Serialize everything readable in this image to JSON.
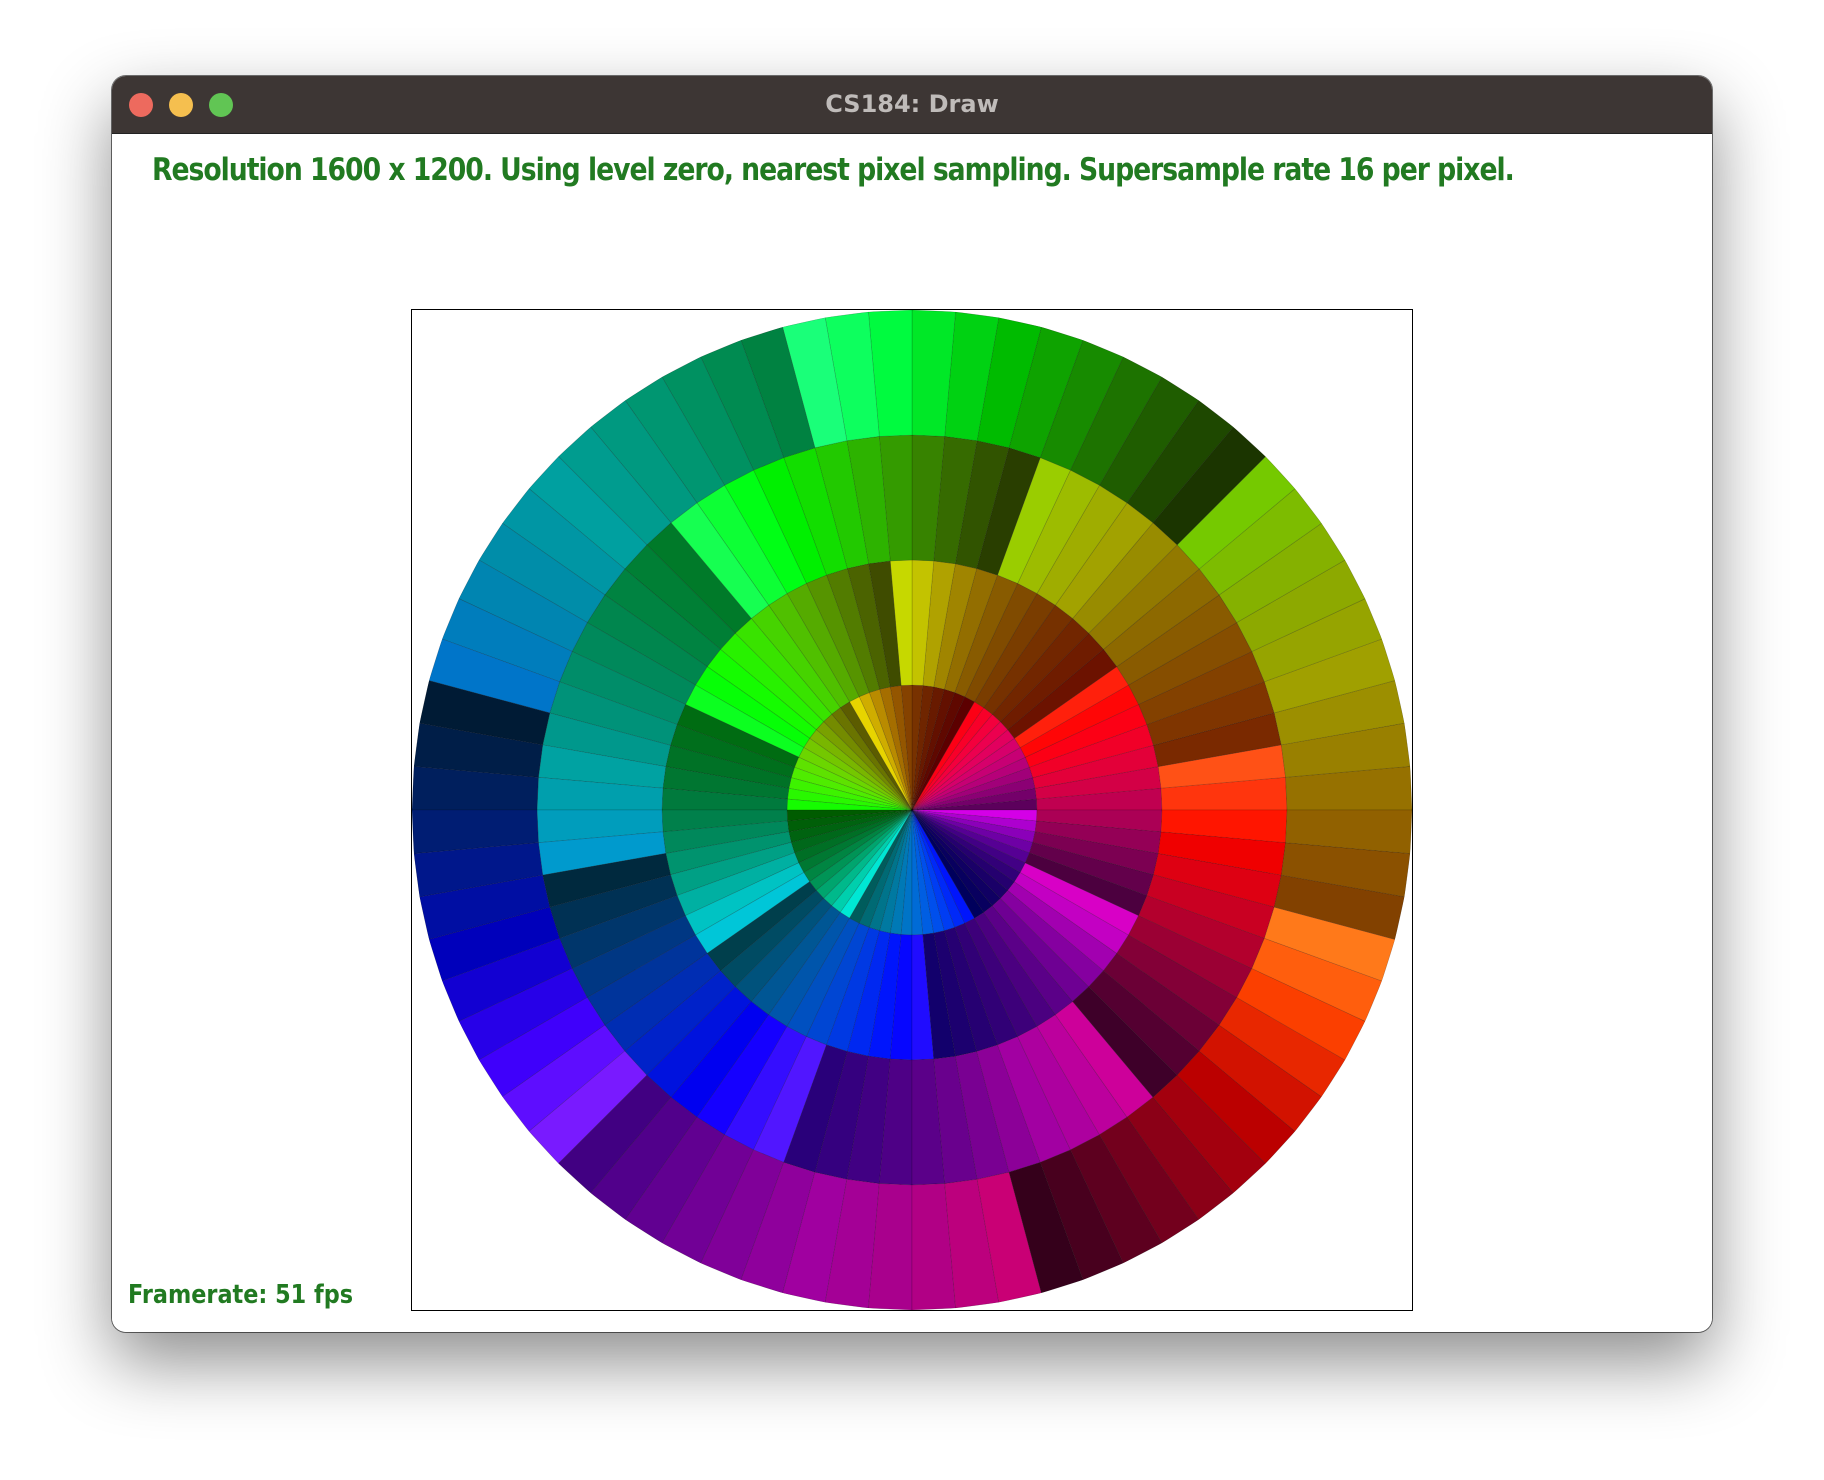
{
  "window": {
    "title": "CS184: Draw"
  },
  "status": {
    "message": "Resolution 1600 x 1200. Using level zero, nearest pixel sampling. Supersample rate 16 per pixel.",
    "framerate": "Framerate: 51 fps"
  },
  "colors": {
    "status_text": "#217a21",
    "titlebar": "#3d3634",
    "close": "#ed6a5e",
    "minimize": "#f5bf4f",
    "zoom": "#61c554"
  },
  "icons": {
    "close": "close-icon",
    "minimize": "minimize-icon",
    "zoom": "zoom-icon"
  }
}
